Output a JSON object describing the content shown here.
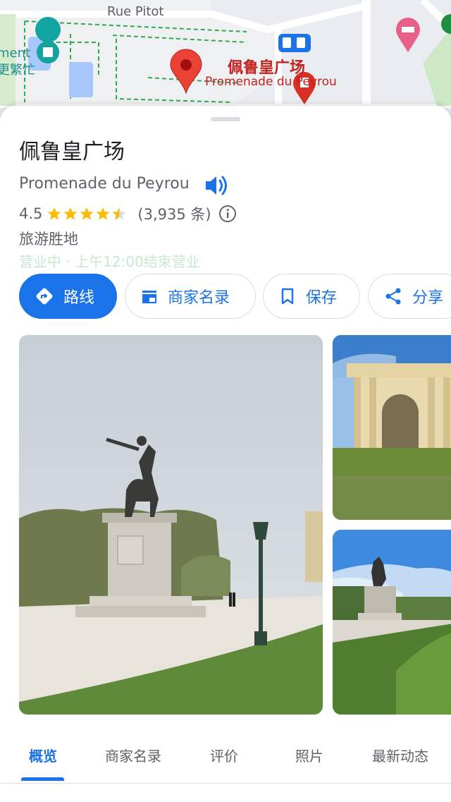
{
  "map": {
    "street_label": "Rue Pitot",
    "left_label_line1": "ment",
    "left_label_line2": "更繁忙",
    "poi_label_zh": "佩鲁皇广场",
    "poi_label_fr": "Promenade du Peyrou"
  },
  "place": {
    "title": "佩鲁皇广场",
    "subtitle": "Promenade du Peyrou",
    "rating": "4.5",
    "rating_value": 4.5,
    "review_count": "(3,935 条)",
    "category": "旅游胜地",
    "hours": "营业中 · 上午12:00结束营业"
  },
  "actions": {
    "directions": "路线",
    "directory": "商家名录",
    "save": "保存",
    "share": "分享"
  },
  "tabs": [
    {
      "label": "概览",
      "active": true
    },
    {
      "label": "商家名录",
      "active": false
    },
    {
      "label": "评价",
      "active": false
    },
    {
      "label": "照片",
      "active": false
    },
    {
      "label": "最新动态",
      "active": false
    }
  ],
  "colors": {
    "accent": "#1a73e8",
    "pin": "#ea4335",
    "star": "#fbbc04",
    "hours_text": "#c7e8cf"
  },
  "icons": [
    "directions-icon",
    "storefront-icon",
    "bookmark-icon",
    "share-icon",
    "speaker-icon",
    "info-icon",
    "map-pin-icon",
    "bus-icon",
    "hotel-icon",
    "landmark-icon"
  ]
}
